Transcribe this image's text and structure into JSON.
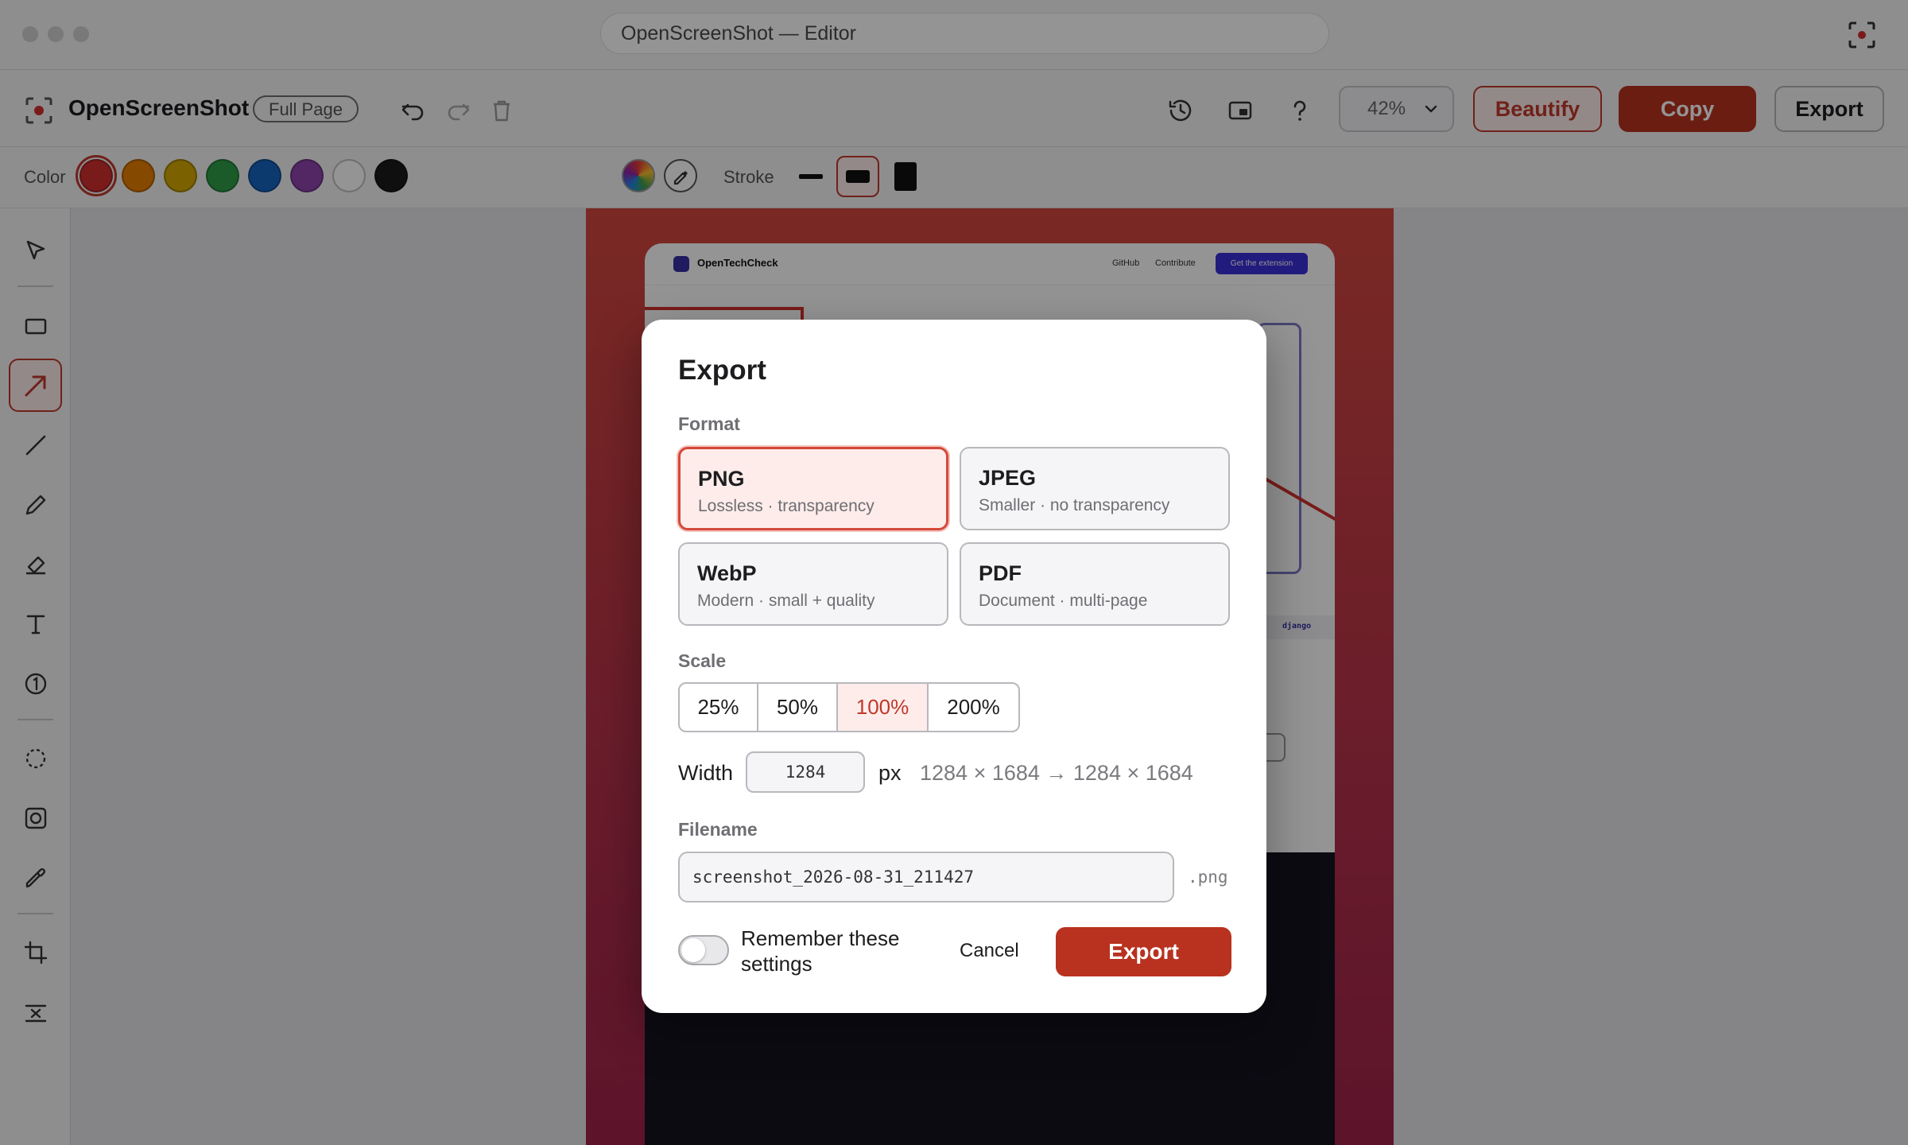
{
  "window": {
    "title": "OpenScreenShot — Editor"
  },
  "toolbar": {
    "app_name": "OpenScreenShot",
    "mode": "Full Page",
    "zoom": "42%",
    "beautify_label": "Beautify",
    "copy_label": "Copy",
    "export_label": "Export"
  },
  "colorbar": {
    "color_label": "Color",
    "stroke_label": "Stroke",
    "swatches": [
      "#d32f2f",
      "#e67e00",
      "#d4a800",
      "#2e9e48",
      "#1565c0",
      "#8e44ad",
      "#ffffff",
      "#1a1a1a"
    ],
    "selected_swatch": 0,
    "selected_stroke": 1
  },
  "tools": [
    "select",
    "rectangle",
    "arrow",
    "line",
    "pencil",
    "highlighter",
    "text",
    "counter",
    "blur",
    "pixelate",
    "eyedropper",
    "crop",
    "remove"
  ],
  "selected_tool": "arrow",
  "canvas_page": {
    "brand": "OpenTechCheck",
    "nav_links": [
      "GitHub",
      "Contribute"
    ],
    "cta": "Get the extension",
    "snippet_label": "django"
  },
  "dialog": {
    "title": "Export",
    "format_label": "Format",
    "formats": [
      {
        "name": "PNG",
        "desc": "Lossless · transparency"
      },
      {
        "name": "JPEG",
        "desc": "Smaller · no transparency"
      },
      {
        "name": "WebP",
        "desc": "Modern · small + quality"
      },
      {
        "name": "PDF",
        "desc": "Document · multi-page"
      }
    ],
    "selected_format": "PNG",
    "scale_label": "Scale",
    "scales": [
      "25%",
      "50%",
      "100%",
      "200%"
    ],
    "selected_scale": "100%",
    "width_label": "Width",
    "width_value": "1284",
    "width_unit": "px",
    "dimensions": "1284 × 1684 → 1284 × 1684",
    "filename_label": "Filename",
    "filename_value": "screenshot_2026-08-31_211427",
    "extension": ".png",
    "remember_label": "Remember these settings",
    "remember_on": false,
    "cancel_label": "Cancel",
    "export_label": "Export"
  }
}
